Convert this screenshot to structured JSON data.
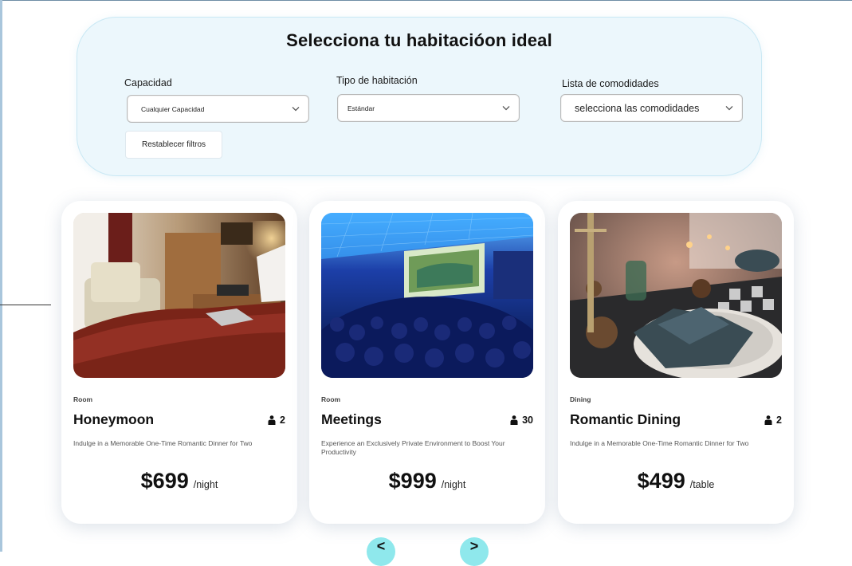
{
  "filters": {
    "title": "Selecciona tu habitacióon ideal",
    "capacity": {
      "label": "Capacidad",
      "value": "Cualquier Capacidad"
    },
    "room_type": {
      "label": "Tipo de habitación",
      "value": "Estándar"
    },
    "amenities": {
      "label": "Lista de comodidades",
      "value": "selecciona las comodidades"
    },
    "reset_label": "Restablecer filtros"
  },
  "cards": [
    {
      "category": "Room",
      "title": "Honeymoon",
      "capacity": "2",
      "description": "Indulge in a Memorable One-Time Romantic Dinner for Two",
      "price": "$699",
      "unit": "/night",
      "image": "hotel bedroom with armchair and red bedspread"
    },
    {
      "category": "Room",
      "title": "Meetings",
      "capacity": "30",
      "description": "Experience an Exclusively Private Environment to Boost Your Productivity",
      "price": "$999",
      "unit": "/night",
      "image": "conference hall audience facing a projection screen"
    },
    {
      "category": "Dining",
      "title": "Romantic Dining",
      "capacity": "2",
      "description": "Indulge in a Memorable One-Time Romantic Dinner for Two",
      "price": "$499",
      "unit": "/table",
      "image": "dinner table with folded napkin, candles and pine cones"
    }
  ],
  "pagination": {
    "prev_label": "<",
    "next_label": ">"
  },
  "icons": {
    "capacity": "person-icon",
    "dropdown": "chevron-down-icon"
  },
  "colors": {
    "panel_bg": "#ecf7fc",
    "panel_border": "#c9e8f4",
    "nav_button": "#8fe8ec"
  }
}
